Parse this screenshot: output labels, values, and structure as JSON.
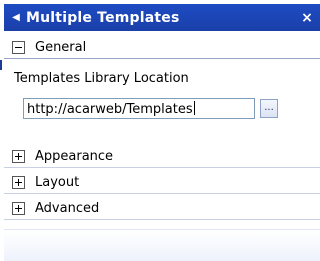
{
  "panel": {
    "title": "Multiple Templates",
    "collapse_icon": "triangle-left-icon",
    "close_icon": "close-icon",
    "close_glyph": "×",
    "arrow_glyph": "◀"
  },
  "sections": {
    "general": {
      "label": "General",
      "expanded": true
    },
    "appearance": {
      "label": "Appearance",
      "expanded": false
    },
    "layout": {
      "label": "Layout",
      "expanded": false
    },
    "advanced": {
      "label": "Advanced",
      "expanded": false
    }
  },
  "general": {
    "library_label": "Templates Library Location",
    "library_value": "http://acarweb/Templates",
    "browse_label": "..."
  },
  "colors": {
    "titlebar": "#1e4cc4",
    "border": "#7f9db9"
  }
}
